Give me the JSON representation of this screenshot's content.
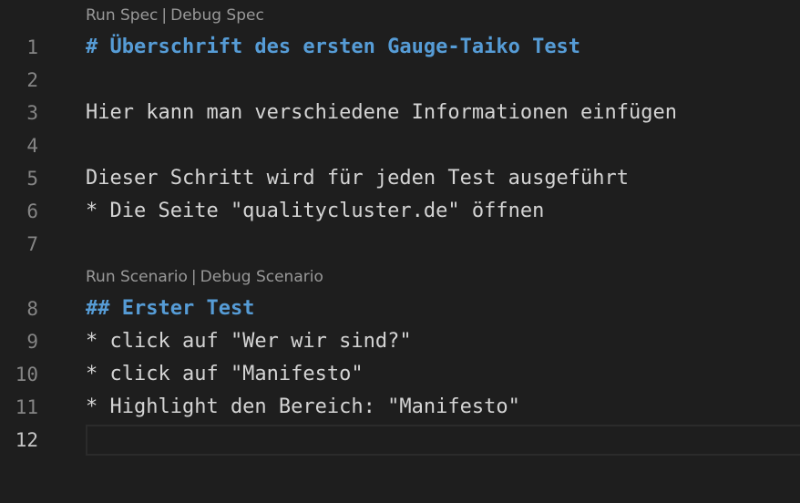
{
  "codelens": {
    "spec": {
      "run": "Run Spec",
      "debug": "Debug Spec",
      "separator": "|"
    },
    "scenario": {
      "run": "Run Scenario",
      "debug": "Debug Scenario",
      "separator": "|"
    }
  },
  "lines": [
    {
      "number": "1",
      "text": "# Überschrift des ersten Gauge-Taiko Test"
    },
    {
      "number": "2",
      "text": ""
    },
    {
      "number": "3",
      "text": "Hier kann man verschiedene Informationen einfügen"
    },
    {
      "number": "4",
      "text": ""
    },
    {
      "number": "5",
      "text": "Dieser Schritt wird für jeden Test ausgeführt"
    },
    {
      "number": "6",
      "text": "* Die Seite \"qualitycluster.de\" öffnen"
    },
    {
      "number": "7",
      "text": ""
    },
    {
      "number": "8",
      "text": "## Erster Test"
    },
    {
      "number": "9",
      "text": "* click auf \"Wer wir sind?\""
    },
    {
      "number": "10",
      "text": "* click auf \"Manifesto\""
    },
    {
      "number": "11",
      "text": "* Highlight den Bereich: \"Manifesto\""
    },
    {
      "number": "12",
      "text": ""
    }
  ],
  "colors": {
    "background": "#1e1e1e",
    "text": "#d4d4d4",
    "heading": "#569cd6",
    "line_number": "#858585",
    "active_line_number": "#c6c6c6",
    "codelens": "#999999"
  }
}
